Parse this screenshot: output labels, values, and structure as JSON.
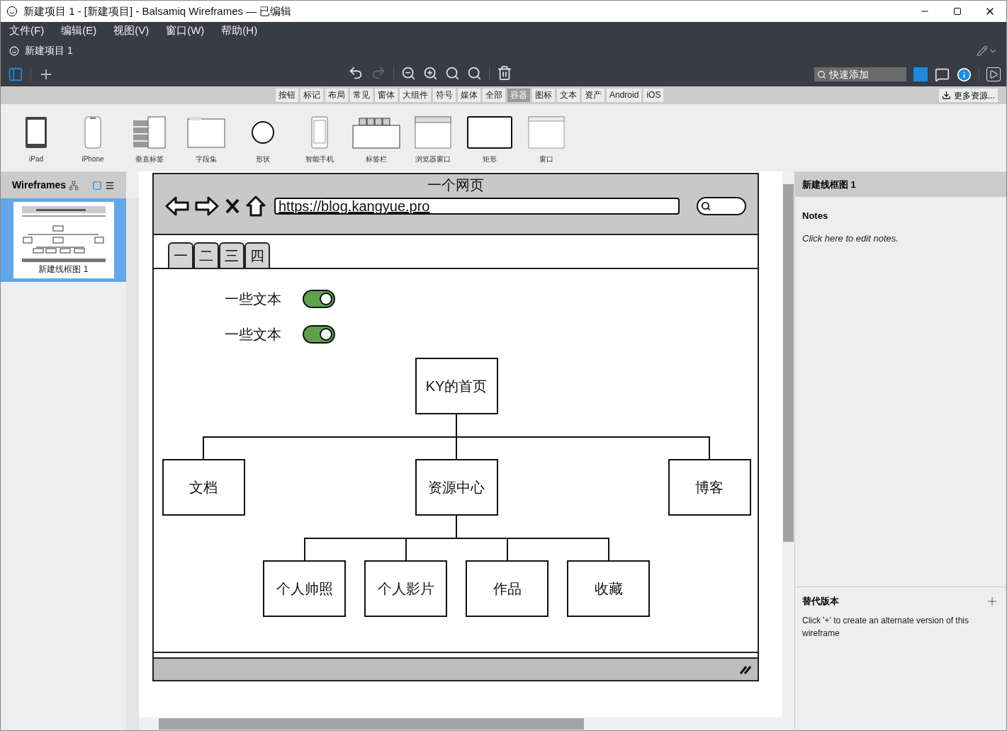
{
  "window": {
    "title": "新建项目 1 - [新建项目] - Balsamiq Wireframes — 已编辑"
  },
  "menu": [
    "文件(F)",
    "编辑(E)",
    "视图(V)",
    "窗口(W)",
    "帮助(H)"
  ],
  "project_tab": {
    "label": "新建项目 1"
  },
  "quick_add": {
    "placeholder": "快速添加"
  },
  "categories": [
    {
      "label": "按钮",
      "selected": false
    },
    {
      "label": "标记",
      "selected": false
    },
    {
      "label": "布局",
      "selected": false
    },
    {
      "label": "常见",
      "selected": false
    },
    {
      "label": "窗体",
      "selected": false
    },
    {
      "label": "大组件",
      "selected": false
    },
    {
      "label": "符号",
      "selected": false
    },
    {
      "label": "媒体",
      "selected": false
    },
    {
      "label": "全部",
      "selected": false
    },
    {
      "label": "容器",
      "selected": true
    },
    {
      "label": "图标",
      "selected": false
    },
    {
      "label": "文本",
      "selected": false
    },
    {
      "label": "资产",
      "selected": false
    },
    {
      "label": "Android",
      "selected": false
    },
    {
      "label": "iOS",
      "selected": false
    }
  ],
  "more_resources": "更多资源...",
  "library": [
    {
      "label": "iPad",
      "kind": "ipad"
    },
    {
      "label": "iPhone",
      "kind": "iphone"
    },
    {
      "label": "垂直标签",
      "kind": "vtabs"
    },
    {
      "label": "字段集",
      "kind": "fieldset"
    },
    {
      "label": "形状",
      "kind": "circle"
    },
    {
      "label": "智能手机",
      "kind": "phone"
    },
    {
      "label": "标签栏",
      "kind": "tabbar"
    },
    {
      "label": "浏览器窗口",
      "kind": "browser"
    },
    {
      "label": "矩形",
      "kind": "rect"
    },
    {
      "label": "窗口",
      "kind": "window"
    }
  ],
  "wireframes_panel": {
    "title": "Wireframes",
    "items": [
      {
        "label": "新建线框图 1",
        "selected": true
      }
    ]
  },
  "mockup": {
    "title": "一个网页",
    "url": "https://blog.kangyue.pro",
    "tabs": [
      "一",
      "二",
      "三",
      "四"
    ],
    "toggles": [
      {
        "label": "一些文本",
        "on": true
      },
      {
        "label": "一些文本",
        "on": true
      }
    ],
    "tree": {
      "label": "KY的首页",
      "children": [
        {
          "label": "文档"
        },
        {
          "label": "资源中心",
          "children": [
            {
              "label": "个人帅照"
            },
            {
              "label": "个人影片"
            },
            {
              "label": "作品"
            },
            {
              "label": "收藏"
            }
          ]
        },
        {
          "label": "博客"
        }
      ]
    }
  },
  "inspector": {
    "title": "新建线框图 1",
    "notes_heading": "Notes",
    "notes_placeholder": "Click here to edit notes.",
    "alt_heading": "替代版本",
    "alt_text": "Click '+' to create an alternate version of this wireframe"
  }
}
